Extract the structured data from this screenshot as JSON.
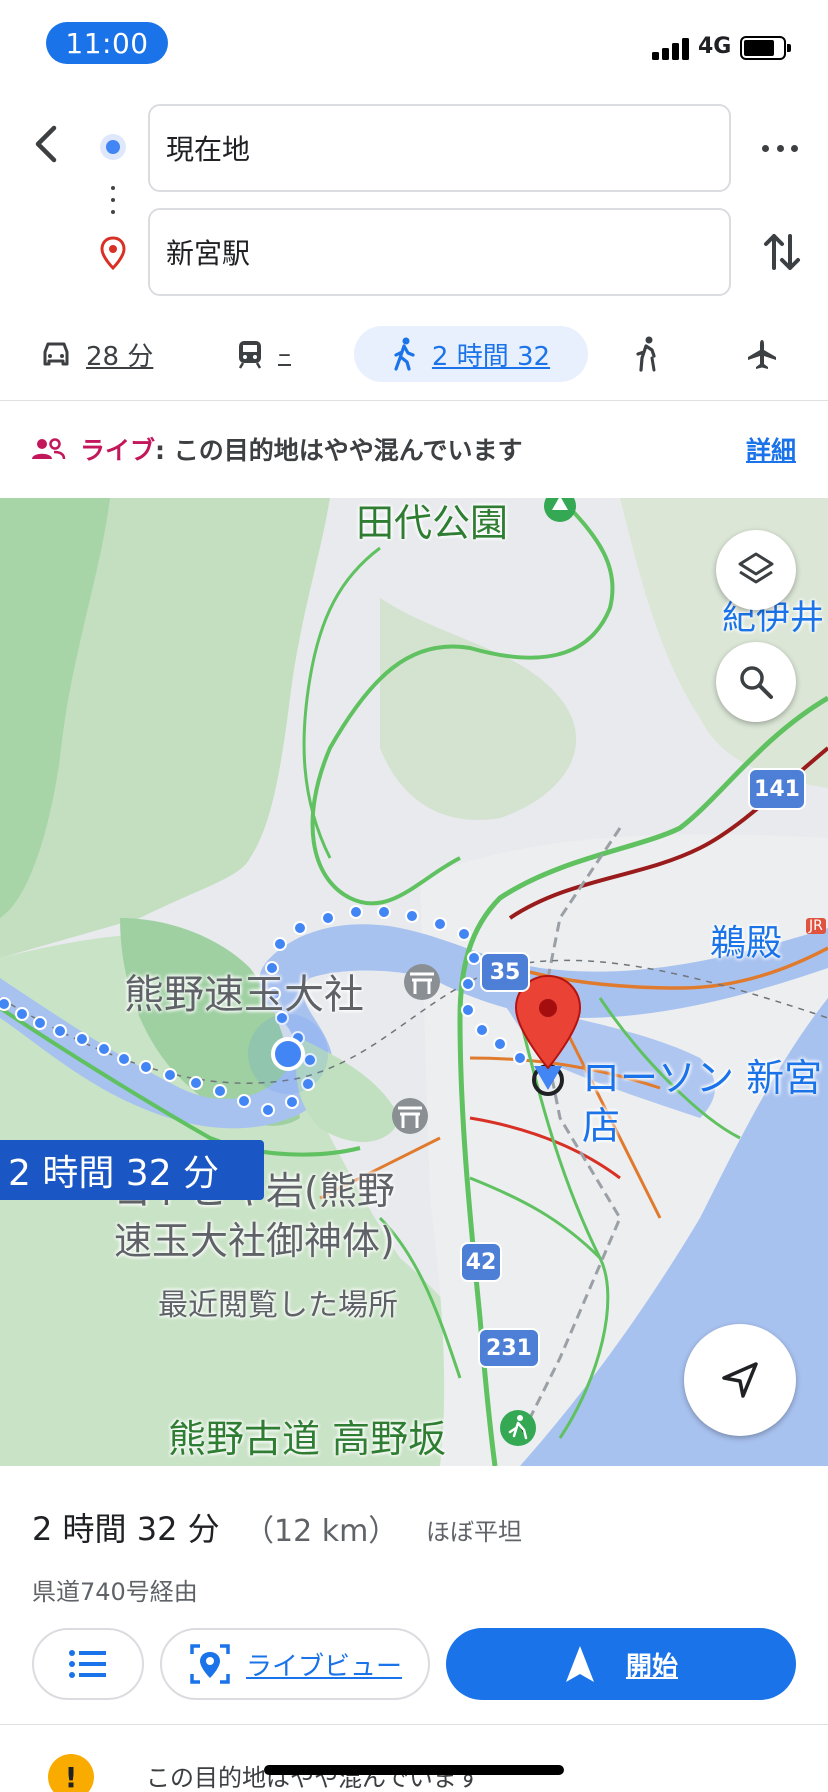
{
  "status_bar": {
    "time": "11:00",
    "network": "4G"
  },
  "route": {
    "origin": "現在地",
    "destination": "新宮駅"
  },
  "modes": {
    "car": {
      "label": "28 分",
      "icon": "car-icon"
    },
    "transit": {
      "label": "–",
      "icon": "train-icon"
    },
    "walk": {
      "label": "2 時間 32",
      "icon": "walk-icon",
      "selected": true
    },
    "ride": {
      "icon": "ride-hailing-icon"
    },
    "flight": {
      "icon": "airplane-icon"
    }
  },
  "live_banner": {
    "live_word": "ライブ",
    "message": ": この目的地はやや混んでいます",
    "details_link": "詳細"
  },
  "map": {
    "labels": {
      "park": "田代公園",
      "kii": "紀伊井",
      "udono": "鵜殿",
      "shrine": "熊野速玉大社",
      "lawson_line1": "ローソン 新宮",
      "lawson_line2": "店",
      "gotobiki_line1": "ゴトビキ岩(熊野",
      "gotobiki_line2": "速玉大社御神体)",
      "recent": "最近閲覧した場所",
      "kodo": "熊野古道 高野坂",
      "jr": "JR"
    },
    "route_shields": [
      "141",
      "35",
      "42",
      "231"
    ],
    "route_time_badge": "2 時間 32 分",
    "colors": {
      "route_blue": "#4285f4",
      "water": "#a8c2f0",
      "park_green": "#a8d5a8"
    }
  },
  "sheet": {
    "duration": "2 時間 32 分",
    "distance": "（12 km）",
    "terrain": "ほぼ平坦",
    "via": "県道740号経由",
    "liveview_label": "ライブビュー",
    "start_label": "開始",
    "warning_icon_text": "!",
    "warning_text": "この目的地はやや混んでいます"
  }
}
